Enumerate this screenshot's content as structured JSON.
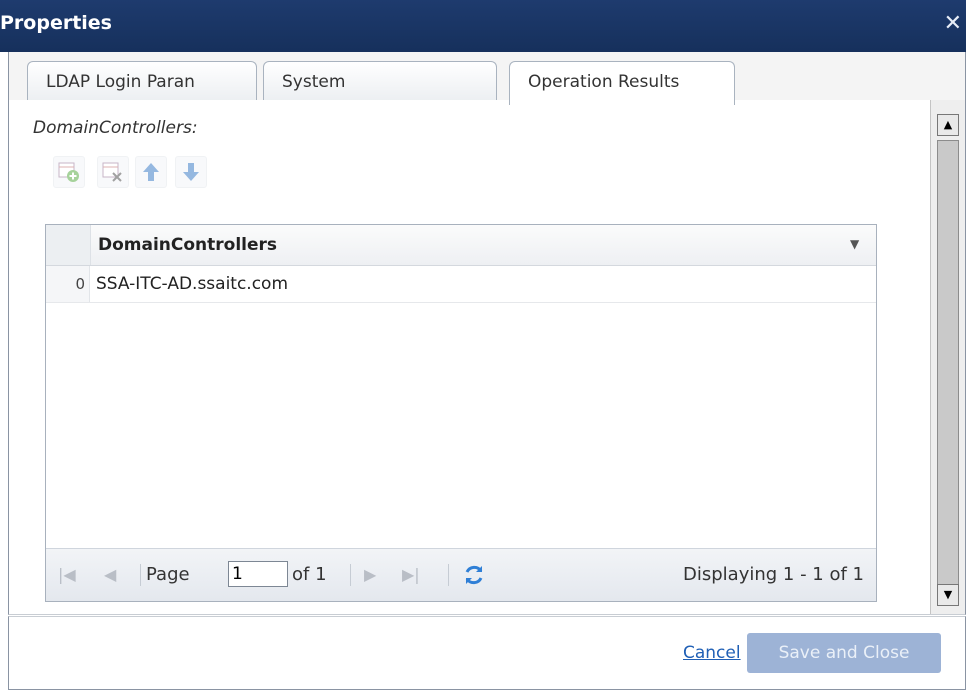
{
  "window": {
    "title": "Properties",
    "close_icon": "close-icon"
  },
  "tabs": [
    {
      "label": "LDAP Login Paran",
      "active": false
    },
    {
      "label": "System",
      "active": false
    },
    {
      "label": "Operation Results",
      "active": true
    }
  ],
  "content": {
    "field_label": "DomainControllers:"
  },
  "toolbar": {
    "buttons": [
      {
        "icon": "add-row-icon",
        "enabled": false
      },
      {
        "icon": "delete-row-icon",
        "enabled": false
      },
      {
        "icon": "arrow-up-icon",
        "enabled": false
      },
      {
        "icon": "arrow-down-icon",
        "enabled": false
      }
    ]
  },
  "grid": {
    "column_header": "DomainControllers",
    "rows": [
      {
        "index": "0",
        "value": "SSA-ITC-AD.ssaitc.com"
      }
    ]
  },
  "pager": {
    "page_label": "Page",
    "page_value": "1",
    "of_label": "of 1",
    "display_text": "Displaying 1 - 1 of 1"
  },
  "footer": {
    "cancel_label": "Cancel",
    "save_label": "Save and Close"
  },
  "colors": {
    "titlebar": "#1e3b6e",
    "link": "#1f5fb5",
    "save_button_disabled": "#9db3d6"
  }
}
